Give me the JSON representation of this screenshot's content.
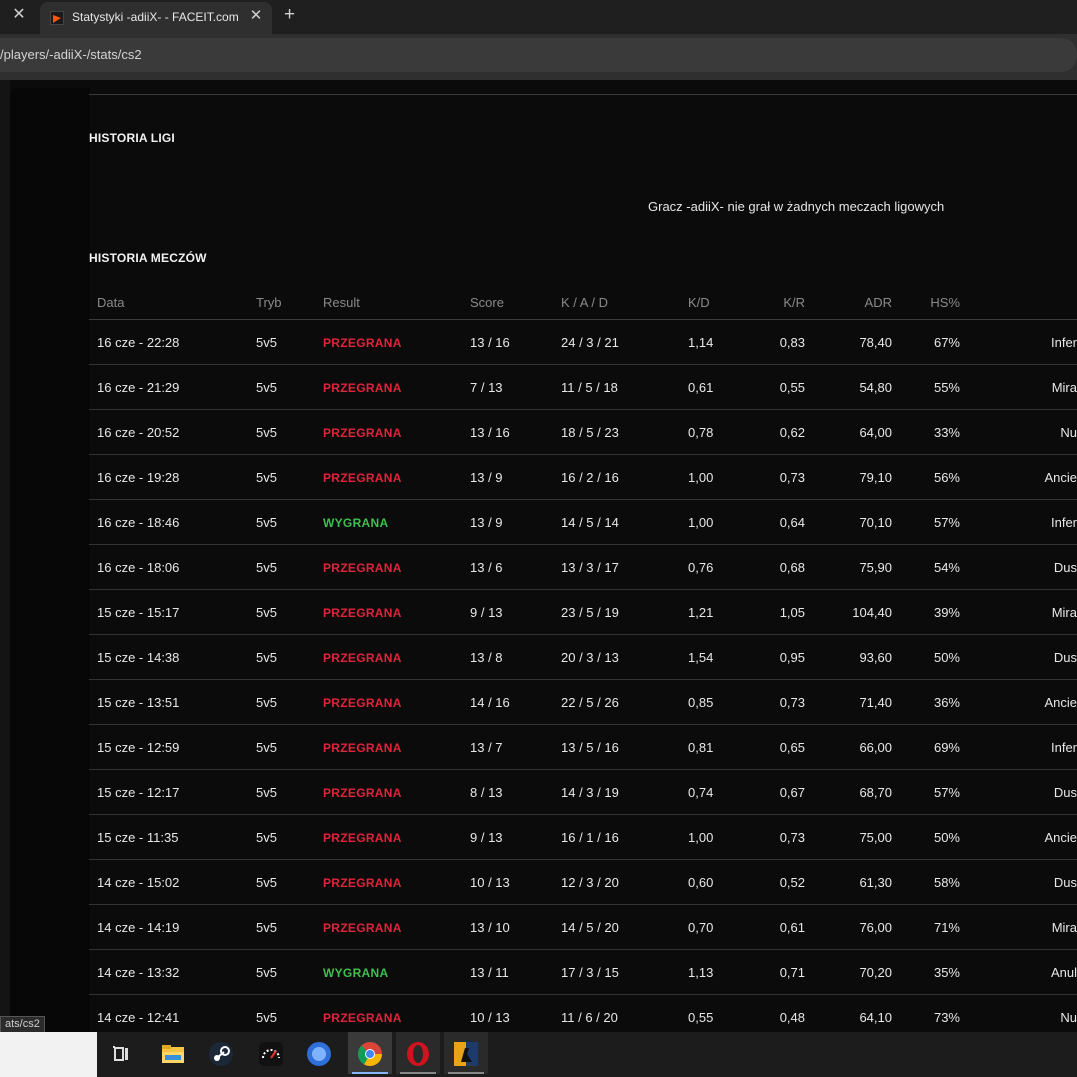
{
  "browser": {
    "tab_title": "Statystyki -adiiX- - FACEIT.com",
    "url": "/players/-adiiX-/stats/cs2",
    "close_glyph": "✕",
    "new_tab_glyph": "+"
  },
  "league": {
    "title": "HISTORIA LIGI",
    "message": "Gracz -adiiX- nie grał w żadnych meczach ligowych"
  },
  "matches": {
    "title": "HISTORIA MECZÓW",
    "headers": {
      "date": "Data",
      "mode": "Tryb",
      "result": "Result",
      "score": "Score",
      "kad": "K / A / D",
      "kd": "K/D",
      "kr": "K/R",
      "adr": "ADR",
      "hs": "HS%"
    },
    "rows": [
      {
        "date": "16 cze - 22:28",
        "mode": "5v5",
        "result": "PRZEGRANA",
        "score": "13 / 16",
        "kad": "24 / 3 / 21",
        "kd": "1,14",
        "kr": "0,83",
        "adr": "78,40",
        "hs": "67%",
        "map": "Infer"
      },
      {
        "date": "16 cze - 21:29",
        "mode": "5v5",
        "result": "PRZEGRANA",
        "score": "7 / 13",
        "kad": "11 / 5 / 18",
        "kd": "0,61",
        "kr": "0,55",
        "adr": "54,80",
        "hs": "55%",
        "map": "Mira"
      },
      {
        "date": "16 cze - 20:52",
        "mode": "5v5",
        "result": "PRZEGRANA",
        "score": "13 / 16",
        "kad": "18 / 5 / 23",
        "kd": "0,78",
        "kr": "0,62",
        "adr": "64,00",
        "hs": "33%",
        "map": "Nu"
      },
      {
        "date": "16 cze - 19:28",
        "mode": "5v5",
        "result": "PRZEGRANA",
        "score": "13 / 9",
        "kad": "16 / 2 / 16",
        "kd": "1,00",
        "kr": "0,73",
        "adr": "79,10",
        "hs": "56%",
        "map": "Ancie"
      },
      {
        "date": "16 cze - 18:46",
        "mode": "5v5",
        "result": "WYGRANA",
        "score": "13 / 9",
        "kad": "14 / 5 / 14",
        "kd": "1,00",
        "kr": "0,64",
        "adr": "70,10",
        "hs": "57%",
        "map": "Infer"
      },
      {
        "date": "16 cze - 18:06",
        "mode": "5v5",
        "result": "PRZEGRANA",
        "score": "13 / 6",
        "kad": "13 / 3 / 17",
        "kd": "0,76",
        "kr": "0,68",
        "adr": "75,90",
        "hs": "54%",
        "map": "Dus"
      },
      {
        "date": "15 cze - 15:17",
        "mode": "5v5",
        "result": "PRZEGRANA",
        "score": "9 / 13",
        "kad": "23 / 5 / 19",
        "kd": "1,21",
        "kr": "1,05",
        "adr": "104,40",
        "hs": "39%",
        "map": "Mira"
      },
      {
        "date": "15 cze - 14:38",
        "mode": "5v5",
        "result": "PRZEGRANA",
        "score": "13 / 8",
        "kad": "20 / 3 / 13",
        "kd": "1,54",
        "kr": "0,95",
        "adr": "93,60",
        "hs": "50%",
        "map": "Dus"
      },
      {
        "date": "15 cze - 13:51",
        "mode": "5v5",
        "result": "PRZEGRANA",
        "score": "14 / 16",
        "kad": "22 / 5 / 26",
        "kd": "0,85",
        "kr": "0,73",
        "adr": "71,40",
        "hs": "36%",
        "map": "Ancie"
      },
      {
        "date": "15 cze - 12:59",
        "mode": "5v5",
        "result": "PRZEGRANA",
        "score": "13 / 7",
        "kad": "13 / 5 / 16",
        "kd": "0,81",
        "kr": "0,65",
        "adr": "66,00",
        "hs": "69%",
        "map": "Infer"
      },
      {
        "date": "15 cze - 12:17",
        "mode": "5v5",
        "result": "PRZEGRANA",
        "score": "8 / 13",
        "kad": "14 / 3 / 19",
        "kd": "0,74",
        "kr": "0,67",
        "adr": "68,70",
        "hs": "57%",
        "map": "Dus"
      },
      {
        "date": "15 cze - 11:35",
        "mode": "5v5",
        "result": "PRZEGRANA",
        "score": "9 / 13",
        "kad": "16 / 1 / 16",
        "kd": "1,00",
        "kr": "0,73",
        "adr": "75,00",
        "hs": "50%",
        "map": "Ancie"
      },
      {
        "date": "14 cze - 15:02",
        "mode": "5v5",
        "result": "PRZEGRANA",
        "score": "10 / 13",
        "kad": "12 / 3 / 20",
        "kd": "0,60",
        "kr": "0,52",
        "adr": "61,30",
        "hs": "58%",
        "map": "Dus"
      },
      {
        "date": "14 cze - 14:19",
        "mode": "5v5",
        "result": "PRZEGRANA",
        "score": "13 / 10",
        "kad": "14 / 5 / 20",
        "kd": "0,70",
        "kr": "0,61",
        "adr": "76,00",
        "hs": "71%",
        "map": "Mira"
      },
      {
        "date": "14 cze - 13:32",
        "mode": "5v5",
        "result": "WYGRANA",
        "score": "13 / 11",
        "kad": "17 / 3 / 15",
        "kd": "1,13",
        "kr": "0,71",
        "adr": "70,20",
        "hs": "35%",
        "map": "Anul"
      },
      {
        "date": "14 cze - 12:41",
        "mode": "5v5",
        "result": "PRZEGRANA",
        "score": "10 / 13",
        "kad": "11 / 6 / 20",
        "kd": "0,55",
        "kr": "0,48",
        "adr": "64,10",
        "hs": "73%",
        "map": "Nu"
      }
    ]
  },
  "status_bar": "ats/cs2",
  "colors": {
    "loss": "#e0243a",
    "win": "#3fbf4f",
    "background": "#0b0b0b"
  },
  "taskbar_icons": [
    "task-view-icon",
    "file-explorer-icon",
    "steam-icon",
    "speed-test-icon",
    "blue-globe-icon",
    "chrome-icon",
    "opera-icon",
    "counter-strike-icon"
  ]
}
